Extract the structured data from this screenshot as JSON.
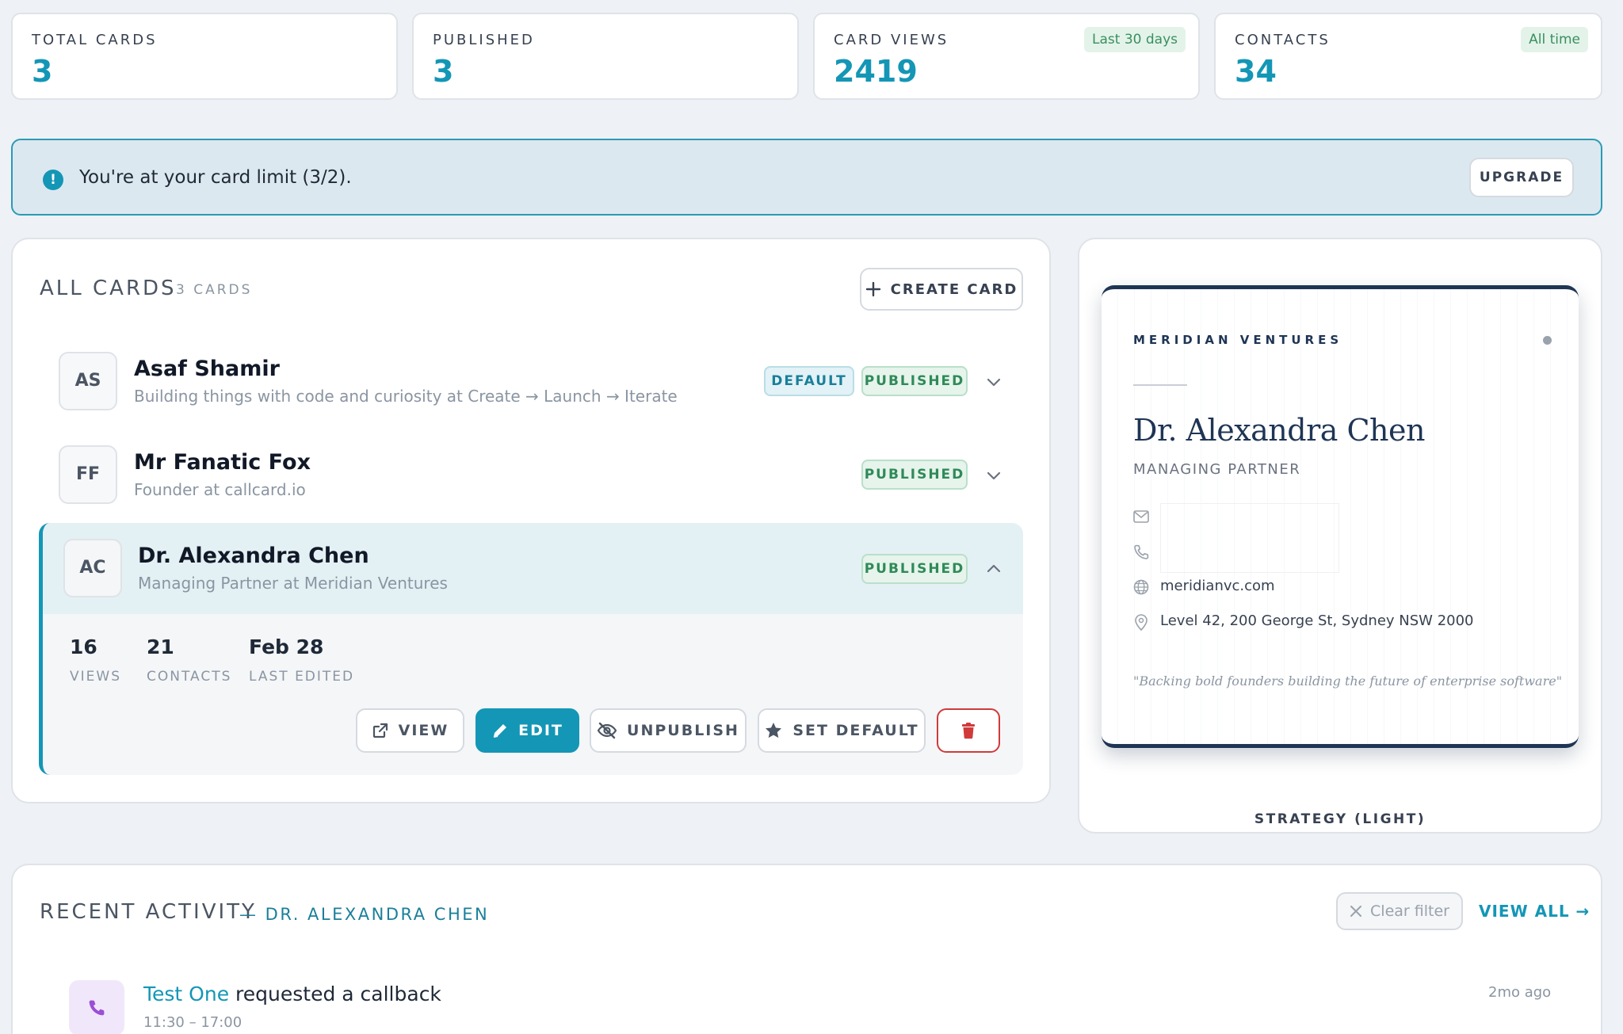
{
  "stats": [
    {
      "label": "TOTAL CARDS",
      "value": "3"
    },
    {
      "label": "PUBLISHED",
      "value": "3"
    },
    {
      "label": "CARD VIEWS",
      "value": "2419",
      "badge": "Last 30 days"
    },
    {
      "label": "CONTACTS",
      "value": "34",
      "badge": "All time"
    }
  ],
  "alert": {
    "text": "You're at your card limit (3/2).",
    "button": "UPGRADE"
  },
  "cards_panel": {
    "title": "ALL CARDS",
    "count": "3 CARDS",
    "create_label": "CREATE CARD",
    "cards": [
      {
        "initials": "AS",
        "name": "Asaf Shamir",
        "subtitle": "Building things with code and curiosity at Create → Launch → Iterate",
        "badges": [
          "DEFAULT",
          "PUBLISHED"
        ]
      },
      {
        "initials": "FF",
        "name": "Mr Fanatic Fox",
        "subtitle": "Founder at callcard.io",
        "badges": [
          "PUBLISHED"
        ]
      },
      {
        "initials": "AC",
        "name": "Dr. Alexandra Chen",
        "subtitle": "Managing Partner at Meridian Ventures",
        "badges": [
          "PUBLISHED"
        ],
        "stats": [
          {
            "value": "16",
            "label": "VIEWS"
          },
          {
            "value": "21",
            "label": "CONTACTS"
          },
          {
            "value": "Feb 28",
            "label": "LAST EDITED"
          }
        ],
        "actions": {
          "view": "VIEW",
          "edit": "EDIT",
          "unpublish": "UNPUBLISH",
          "set_default": "SET DEFAULT"
        }
      }
    ]
  },
  "preview": {
    "company": "MERIDIAN VENTURES",
    "name": "Dr. Alexandra Chen",
    "role": "MANAGING PARTNER",
    "website": "meridianvc.com",
    "address": "Level 42, 200 George St, Sydney NSW 2000",
    "quote": "\"Backing bold founders building the future of enterprise software\"",
    "theme": "STRATEGY (LIGHT)"
  },
  "activity": {
    "title": "RECENT ACTIVITY",
    "filter_name": "— DR. ALEXANDRA CHEN",
    "clear_filter": "Clear filter",
    "view_all": "VIEW ALL →",
    "items": [
      {
        "who": "Test One",
        "action": "requested a callback",
        "detail": "11:30 – 17:00",
        "time": "2mo ago"
      }
    ]
  },
  "colors": {
    "accent": "#1496b6",
    "published": "#2f8a58",
    "danger": "#d03a3a",
    "navy": "#1f3555"
  }
}
